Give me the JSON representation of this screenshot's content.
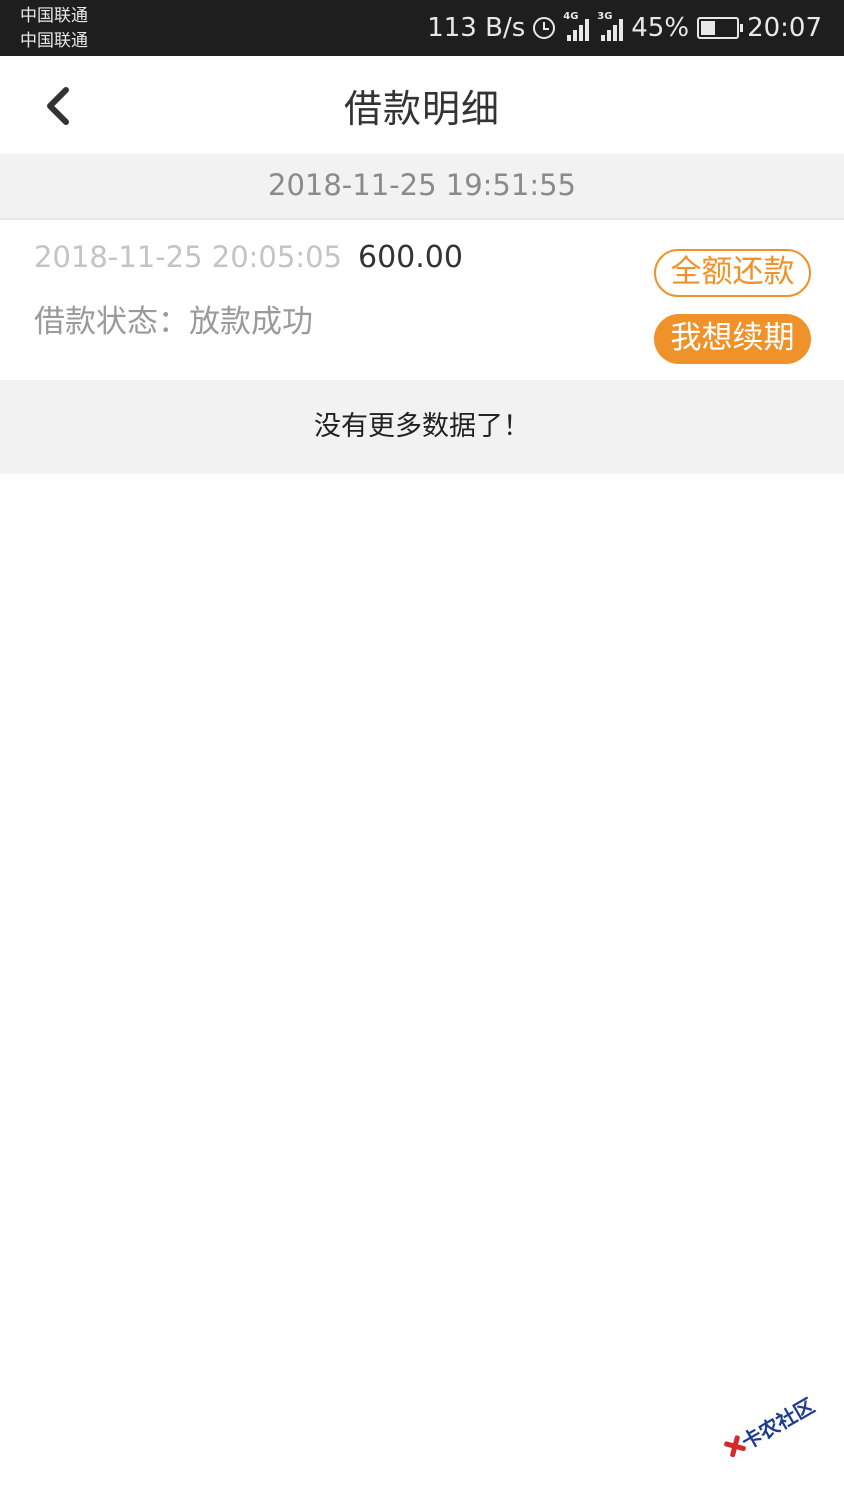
{
  "status_bar": {
    "carrier_1": "中国联通",
    "carrier_2": "中国联通",
    "net_speed": "113 B/s",
    "signal_1_type": "4G",
    "signal_2_type": "3G",
    "battery": "45%",
    "battery_level": 0.45,
    "time": "20:07",
    "icons": [
      "alarm-icon",
      "signal-4g-icon",
      "signal-3g-icon",
      "battery-icon"
    ]
  },
  "nav": {
    "title": "借款明细",
    "back_icon": "chevron-left-icon"
  },
  "section": {
    "date": "2018-11-25 19:51:55"
  },
  "loan": {
    "time": "2018-11-25 20:05:05",
    "amount": "600.00",
    "status_text": "借款状态：放款成功",
    "repay_button": "全额还款",
    "renew_button": "我想续期"
  },
  "footer": {
    "no_more": "没有更多数据了！"
  },
  "watermark": {
    "text": "卡农社区"
  },
  "colors": {
    "accent": "#f0922a",
    "status_bar_bg": "#1e1e1e",
    "section_bg": "#f2f2f2",
    "muted_text": "#c4c4c4"
  }
}
